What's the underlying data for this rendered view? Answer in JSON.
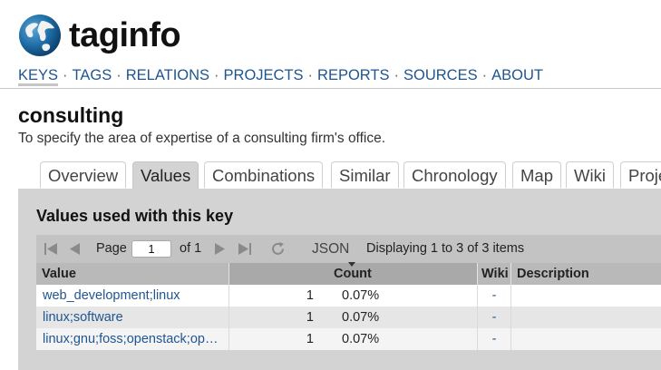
{
  "logo": {
    "part1": "tag",
    "part2": "info"
  },
  "nav": {
    "items": [
      "KEYS",
      "TAGS",
      "RELATIONS",
      "PROJECTS",
      "REPORTS",
      "SOURCES",
      "ABOUT"
    ],
    "separator": "·"
  },
  "key": {
    "title": "consulting",
    "description": "To specify the area of expertise of a consulting firm's office."
  },
  "tabs": [
    "Overview",
    "Values",
    "Combinations",
    "Similar",
    "Chronology",
    "Map",
    "Wiki",
    "Proje"
  ],
  "panel": {
    "title": "Values used with this key"
  },
  "pager": {
    "page_label": "Page",
    "page_value": "1",
    "of_label": "of 1",
    "json_label": "JSON",
    "display_text": "Displaying 1 to 3 of 3 items"
  },
  "table": {
    "headers": [
      "Value",
      "Count",
      "Wiki",
      "Description"
    ],
    "rows": [
      {
        "value": "web_development;linux",
        "count": "1",
        "percent": "0.07%",
        "wiki": "-"
      },
      {
        "value": "linux;software",
        "count": "1",
        "percent": "0.07%",
        "wiki": "-"
      },
      {
        "value": "linux;gnu;foss;openstack;op…",
        "count": "1",
        "percent": "0.07%",
        "wiki": "-"
      }
    ]
  }
}
